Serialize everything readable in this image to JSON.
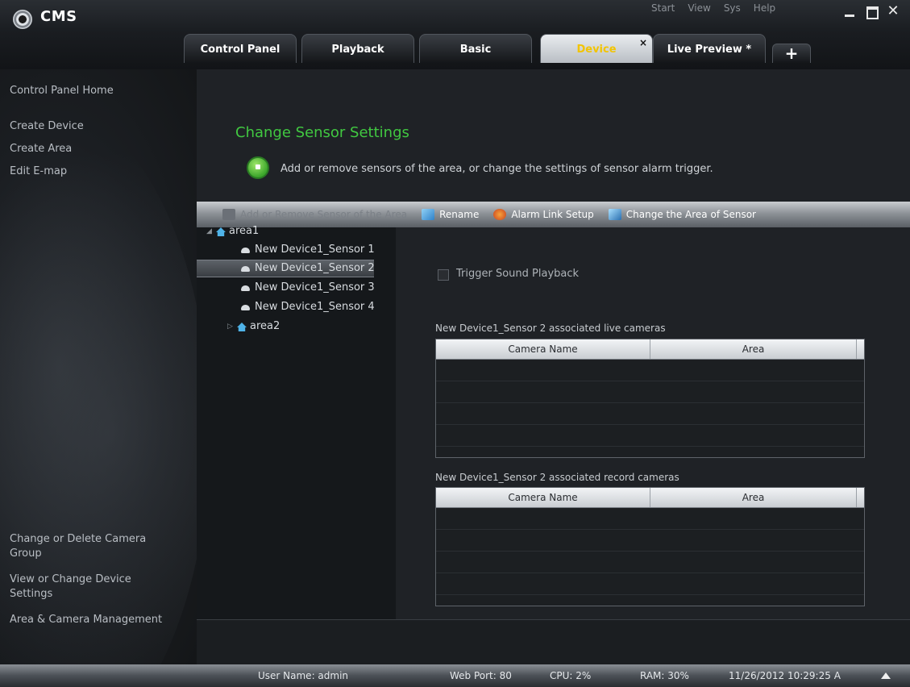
{
  "app": {
    "title": "CMS"
  },
  "top_menu": [
    "Start",
    "View",
    "Sys",
    "Help"
  ],
  "tabs": [
    {
      "label": "Control Panel",
      "active": false
    },
    {
      "label": "Playback",
      "active": false
    },
    {
      "label": "Basic",
      "active": false
    },
    {
      "label": "Device",
      "active": true
    },
    {
      "label": "Live Preview *",
      "active": false
    }
  ],
  "tab_add_label": "+",
  "tab_close_label": "×",
  "sidebar": {
    "top_items": [
      "Control Panel Home",
      "Create Device",
      "Create Area",
      "Edit E-map"
    ],
    "bottom_items": [
      "Change or Delete Camera Group",
      "View or Change Device Settings",
      "Area & Camera Management"
    ]
  },
  "main": {
    "title": "Change Sensor Settings",
    "description": "Add or remove sensors of the area, or change the settings of sensor alarm trigger."
  },
  "toolbar": [
    {
      "label": "Add or Remove Sensor of the Area",
      "icon": "sensor-add-icon",
      "enabled": false
    },
    {
      "label": "Rename",
      "icon": "rename-icon",
      "enabled": true
    },
    {
      "label": "Alarm Link Setup",
      "icon": "alarm-link-icon",
      "enabled": true
    },
    {
      "label": "Change the Area of Sensor",
      "icon": "change-area-icon",
      "enabled": true
    }
  ],
  "tree": {
    "area1": "area1",
    "sensors": [
      "New Device1_Sensor 1",
      "New Device1_Sensor 2",
      "New Device1_Sensor 3",
      "New Device1_Sensor 4"
    ],
    "selected_sensor": "New Device1_Sensor 2",
    "area2": "area2"
  },
  "detail": {
    "trigger_sound_label": "Trigger Sound Playback",
    "trigger_sound_checked": false,
    "live_caption": "New Device1_Sensor 2 associated live cameras",
    "record_caption": "New Device1_Sensor 2 associated record cameras",
    "columns": [
      "Camera Name",
      "Area"
    ]
  },
  "status_bar": {
    "user": "User Name: admin",
    "web_port": "Web Port: 80",
    "cpu": "CPU: 2%",
    "ram": "RAM: 30%",
    "datetime": "11/26/2012  10:29:25 A"
  },
  "colors": {
    "accent_green": "#41c841",
    "active_tab_text": "#f2c400",
    "link_blue": "#4fb3e8"
  }
}
